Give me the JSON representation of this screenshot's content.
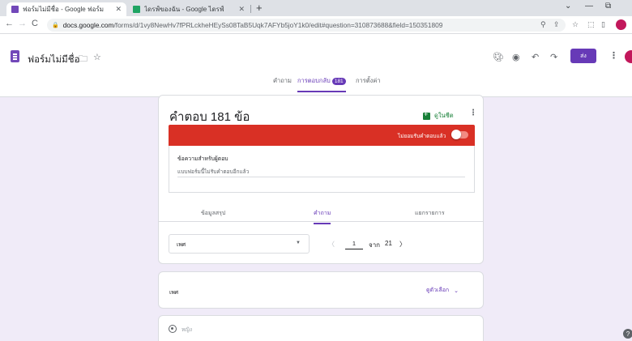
{
  "browser": {
    "tabs": [
      {
        "title": "ฟอร์มไม่มีชื่อ - Google ฟอร์ม",
        "active": true,
        "favicon_color": "#7248b9"
      },
      {
        "title": "ไดรฟ์ของฉัน - Google ไดรฟ์",
        "active": false,
        "favicon_color": "#1fa463"
      }
    ],
    "url_domain": "docs.google.com",
    "url_path": "/forms/d/1vy8NewHv7fPRLckheHEySs08TaB5Uqk7AFYb5joY1k0/edit#question=310873688&field=150351809"
  },
  "header": {
    "form_title": "ฟอร์มไม่มีชื่อ",
    "send_label": "ส่ง",
    "nav_tabs": [
      {
        "label": "คำถาม",
        "active": false
      },
      {
        "label": "การตอบกลับ",
        "active": true,
        "badge": "181"
      },
      {
        "label": "การตั้งค่า",
        "active": false
      }
    ]
  },
  "responses": {
    "title": "คำตอบ 181 ข้อ",
    "sheets_link": "ดูในชีต",
    "not_accepting": "ไม่ยอมรับคำตอบแล้ว",
    "message_label": "ข้อความสำหรับผู้ตอบ",
    "message_value": "แบบฟอร์มนี้ไม่รับคำตอบอีกแล้ว",
    "sub_tabs": [
      {
        "label": "ข้อมูลสรุป",
        "active": false
      },
      {
        "label": "คำถาม",
        "active": true
      },
      {
        "label": "แยกรายการ",
        "active": false
      }
    ],
    "selected_question": "เพศ",
    "pager": {
      "current": "1",
      "of_label": "จาก",
      "total": "21"
    }
  },
  "question_card": {
    "title": "เพศ",
    "see_options": "ดูตัวเลือก"
  },
  "option_card": {
    "option_label": "หญิง"
  },
  "colors": {
    "accent": "#673ab7",
    "alert": "#d93025",
    "sheets": "#188038",
    "background": "#f0ebf8"
  }
}
